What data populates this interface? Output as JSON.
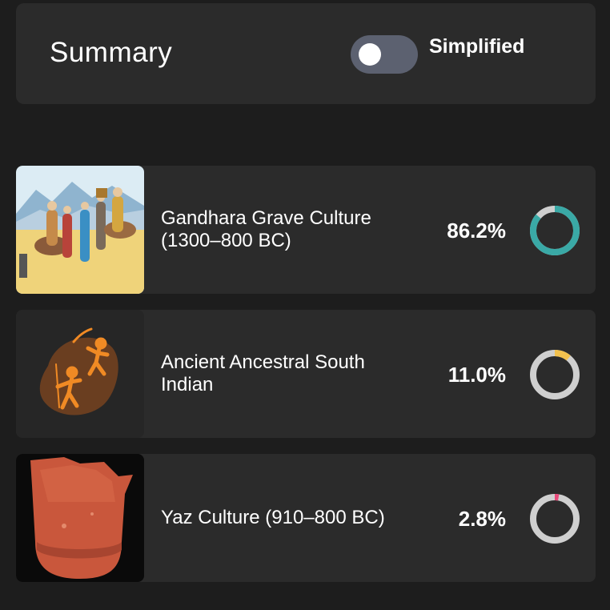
{
  "header": {
    "title": "Summary",
    "toggle_label": "Simplified",
    "toggle_on": false
  },
  "populations": [
    {
      "name": "Gandhara Grave Culture (1300–800 BC)",
      "percent_label": "86.2%",
      "value": 86.2,
      "color": "#3aa9a6",
      "thumb_icon": "caravan-painting-image"
    },
    {
      "name": "Ancient Ancestral South Indian",
      "percent_label": "11.0%",
      "value": 11.0,
      "color": "#f2c14e",
      "thumb_icon": "rock-art-hunters-image"
    },
    {
      "name": "Yaz Culture (910–800 BC)",
      "percent_label": "2.8%",
      "value": 2.8,
      "color": "#e8497a",
      "thumb_icon": "pottery-shard-image"
    }
  ],
  "colors": {
    "background": "#1d1d1d",
    "card": "#2b2b2b",
    "donut_track": "#cfcfcf",
    "toggle_track": "#5c6170"
  }
}
